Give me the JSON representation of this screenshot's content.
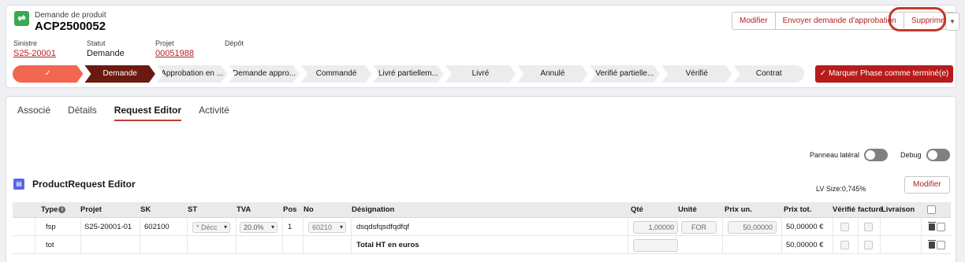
{
  "record": {
    "object_type": "Demande de produit",
    "name": "ACP2500052",
    "icon": "product-request-icon"
  },
  "actions": {
    "modifier": "Modifier",
    "envoyer": "Envoyer demande d'approbation",
    "supprimer": "Supprimer",
    "more_icon": "chevron-down-icon"
  },
  "fields": {
    "sinistre_label": "Sinistre",
    "sinistre_value": "S25-20001",
    "statut_label": "Statut",
    "statut_value": "Demande",
    "projet_label": "Projet",
    "projet_value": "00051988",
    "depot_label": "Dépôt",
    "depot_value": ""
  },
  "path": {
    "stages": [
      {
        "label": "✓",
        "state": "done"
      },
      {
        "label": "Demande",
        "state": "current"
      },
      {
        "label": "Approbation en ...",
        "state": "todo"
      },
      {
        "label": "Demande appro...",
        "state": "todo"
      },
      {
        "label": "Commandé",
        "state": "todo"
      },
      {
        "label": "Livré partiellem...",
        "state": "todo"
      },
      {
        "label": "Livré",
        "state": "todo"
      },
      {
        "label": "Annulé",
        "state": "todo"
      },
      {
        "label": "Verifié partielle...",
        "state": "todo"
      },
      {
        "label": "Vérifié",
        "state": "todo"
      },
      {
        "label": "Contrat",
        "state": "todo"
      }
    ],
    "mark_complete": "✓  Marquer Phase comme terminé(e)"
  },
  "tabs": [
    "Associé",
    "Détails",
    "Request Editor",
    "Activité"
  ],
  "active_tab": "Request Editor",
  "toggles": {
    "panneau_label": "Panneau latéral",
    "debug_label": "Debug"
  },
  "editor": {
    "title": "ProductRequest Editor",
    "lv_size": "LV Size:0,745%",
    "modifier": "Modifier"
  },
  "table": {
    "headers": {
      "type": "Type",
      "projet": "Projet",
      "sk": "SK",
      "st": "ST",
      "tva": "TVA",
      "pos": "Pos",
      "no": "No",
      "designation": "Désignation",
      "qte": "Qté",
      "unite": "Unité",
      "prix_un": "Prix un.",
      "prix_tot": "Prix tot.",
      "verifie": "Vérifié",
      "facture": "facturé",
      "livraison": "Livraison"
    },
    "row1": {
      "type": "fsp",
      "projet": "S25-20001-01",
      "sk": "602100",
      "st": "* Décc",
      "tva": "20.0%",
      "pos": "1",
      "no": "60210",
      "designation": "dsqdsfqsdfqdfqf",
      "qte": "1,00000",
      "unite": "FOR",
      "prix_un": "50,00000",
      "prix_tot": "50,00000 €"
    },
    "row2": {
      "type": "tot",
      "designation": "Total HT en euros",
      "prix_tot": "50,00000 €"
    }
  }
}
